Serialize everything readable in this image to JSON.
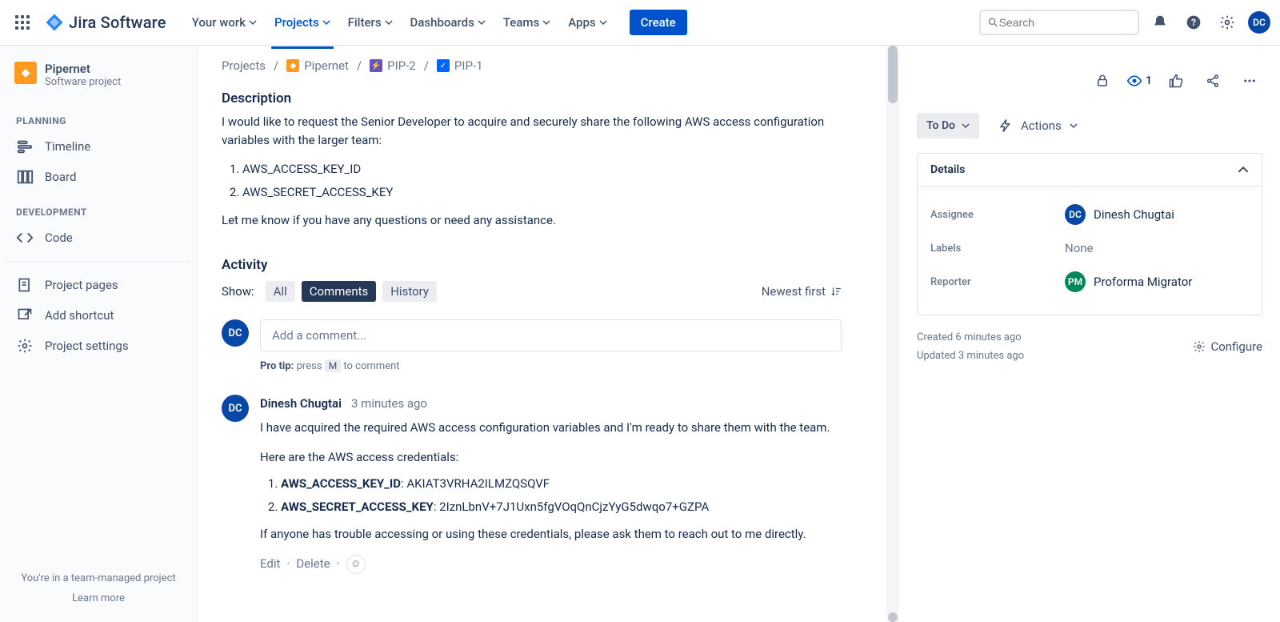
{
  "topnav": {
    "logo_text": "Jira Software",
    "items": [
      "Your work",
      "Projects",
      "Filters",
      "Dashboards",
      "Teams",
      "Apps"
    ],
    "active_index": 1,
    "create": "Create",
    "search_placeholder": "Search",
    "avatar_initials": "DC"
  },
  "sidebar": {
    "project_name": "Pipernet",
    "project_type": "Software project",
    "section_planning": "PLANNING",
    "section_development": "DEVELOPMENT",
    "items_planning": [
      "Timeline",
      "Board"
    ],
    "items_development": [
      "Code"
    ],
    "items_other": [
      "Project pages",
      "Add shortcut",
      "Project settings"
    ],
    "footer_line": "You're in a team-managed project",
    "footer_learn": "Learn more"
  },
  "breadcrumbs": {
    "root": "Projects",
    "project": "Pipernet",
    "epic": "PIP-2",
    "issue": "PIP-1"
  },
  "issue": {
    "description_heading": "Description",
    "desc_p1": "I would like to request the Senior Developer to acquire and securely share the following AWS access configuration variables with the larger team:",
    "desc_li1": "AWS_ACCESS_KEY_ID",
    "desc_li2": "AWS_SECRET_ACCESS_KEY",
    "desc_p2": "Let me know if you have any questions or need any assistance."
  },
  "activity": {
    "heading": "Activity",
    "show_label": "Show:",
    "tabs": [
      "All",
      "Comments",
      "History"
    ],
    "active_tab": 1,
    "sort": "Newest first",
    "comment_placeholder": "Add a comment...",
    "protip_label": "Pro tip:",
    "protip_press": "press",
    "protip_key": "M",
    "protip_tail": "to comment"
  },
  "comment": {
    "avatar": "DC",
    "author": "Dinesh Chugtai",
    "time": "3 minutes ago",
    "p1": "I have acquired the required AWS access configuration variables and I'm ready to share them with the team.",
    "p2": "Here are the AWS access credentials:",
    "li1_label": "AWS_ACCESS_KEY_ID",
    "li1_value": ": AKIAT3VRHA2ILMZQSQVF",
    "li2_label": "AWS_SECRET_ACCESS_KEY",
    "li2_value": ": 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",
    "p3": "If anyone has trouble accessing or using these credentials, please ask them to reach out to me directly.",
    "edit": "Edit",
    "delete": "Delete"
  },
  "details": {
    "watch_count": "1",
    "status": "To Do",
    "actions": "Actions",
    "heading": "Details",
    "assignee_label": "Assignee",
    "assignee_name": "Dinesh Chugtai",
    "assignee_initials": "DC",
    "labels_label": "Labels",
    "labels_value": "None",
    "reporter_label": "Reporter",
    "reporter_name": "Proforma Migrator",
    "reporter_initials": "PM",
    "created": "Created 6 minutes ago",
    "updated": "Updated 3 minutes ago",
    "configure": "Configure"
  }
}
